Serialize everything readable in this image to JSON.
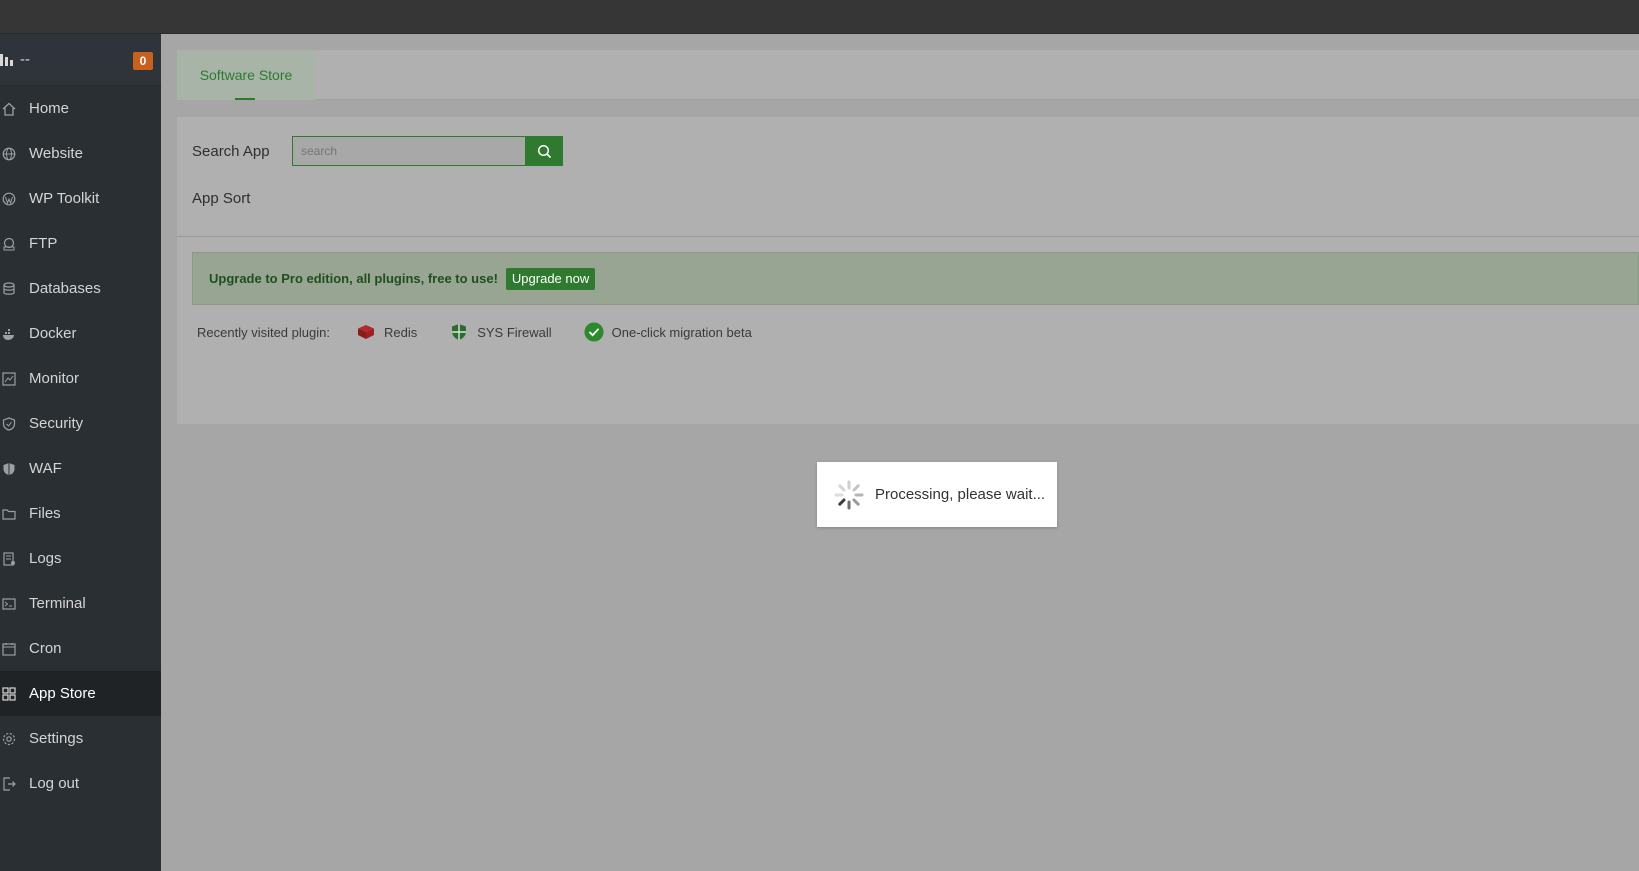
{
  "sidebar": {
    "server_name": "--",
    "badge_count": "0",
    "items": [
      {
        "label": "Home",
        "icon": "home-icon"
      },
      {
        "label": "Website",
        "icon": "globe-icon"
      },
      {
        "label": "WP Toolkit",
        "icon": "wordpress-icon"
      },
      {
        "label": "FTP",
        "icon": "ftp-icon"
      },
      {
        "label": "Databases",
        "icon": "database-icon"
      },
      {
        "label": "Docker",
        "icon": "docker-icon"
      },
      {
        "label": "Monitor",
        "icon": "monitor-icon"
      },
      {
        "label": "Security",
        "icon": "shield-icon"
      },
      {
        "label": "WAF",
        "icon": "waf-icon"
      },
      {
        "label": "Files",
        "icon": "folder-icon"
      },
      {
        "label": "Logs",
        "icon": "logs-icon"
      },
      {
        "label": "Terminal",
        "icon": "terminal-icon"
      },
      {
        "label": "Cron",
        "icon": "calendar-icon"
      },
      {
        "label": "App Store",
        "icon": "grid-icon",
        "active": true
      },
      {
        "label": "Settings",
        "icon": "gear-icon"
      },
      {
        "label": "Log out",
        "icon": "logout-icon"
      }
    ]
  },
  "tabs": [
    {
      "label": "Software Store",
      "active": true
    }
  ],
  "search": {
    "label": "Search App",
    "placeholder": "search"
  },
  "app_sort_label": "App Sort",
  "promo": {
    "text": "Upgrade to Pro edition, all plugins, free to use!",
    "button": "Upgrade now"
  },
  "recent": {
    "label": "Recently visited plugin:",
    "plugins": [
      {
        "label": "Redis",
        "icon": "redis-icon"
      },
      {
        "label": "SYS Firewall",
        "icon": "firewall-shield-icon"
      },
      {
        "label": "One-click migration beta",
        "icon": "check-circle-icon"
      }
    ]
  },
  "loading": {
    "text": "Processing, please wait..."
  },
  "colors": {
    "accent": "#2f7a2f",
    "badge": "#c8601e",
    "sidebar": "#2a2f33"
  }
}
